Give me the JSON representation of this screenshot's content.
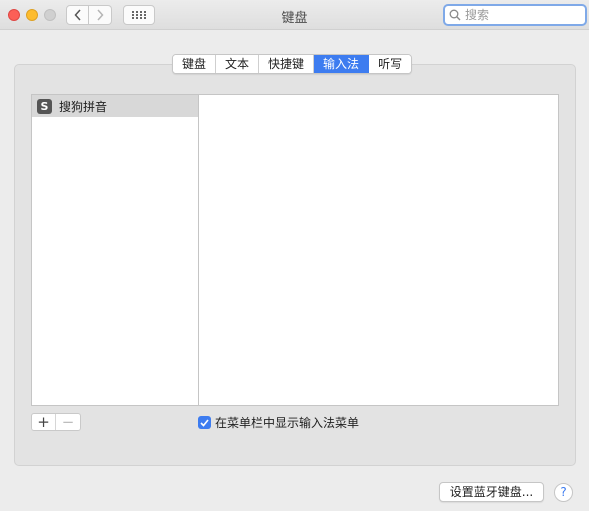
{
  "window": {
    "title": "键盘"
  },
  "search": {
    "placeholder": "搜索",
    "value": ""
  },
  "tabs": [
    {
      "label": "键盘",
      "active": false
    },
    {
      "label": "文本",
      "active": false
    },
    {
      "label": "快捷键",
      "active": false
    },
    {
      "label": "输入法",
      "active": true
    },
    {
      "label": "听写",
      "active": false
    }
  ],
  "input_sources": [
    {
      "label": "搜狗拼音",
      "icon": "sogou-icon",
      "selected": true
    }
  ],
  "options": {
    "show_menu_label": "在菜单栏中显示输入法菜单",
    "show_menu_checked": true
  },
  "buttons": {
    "add": "+",
    "remove": "−",
    "bluetooth_keyboard": "设置蓝牙键盘...",
    "help": "?"
  },
  "colors": {
    "accent": "#3d7cf0",
    "close": "#fc5f57",
    "minimize": "#fdbc2e"
  }
}
